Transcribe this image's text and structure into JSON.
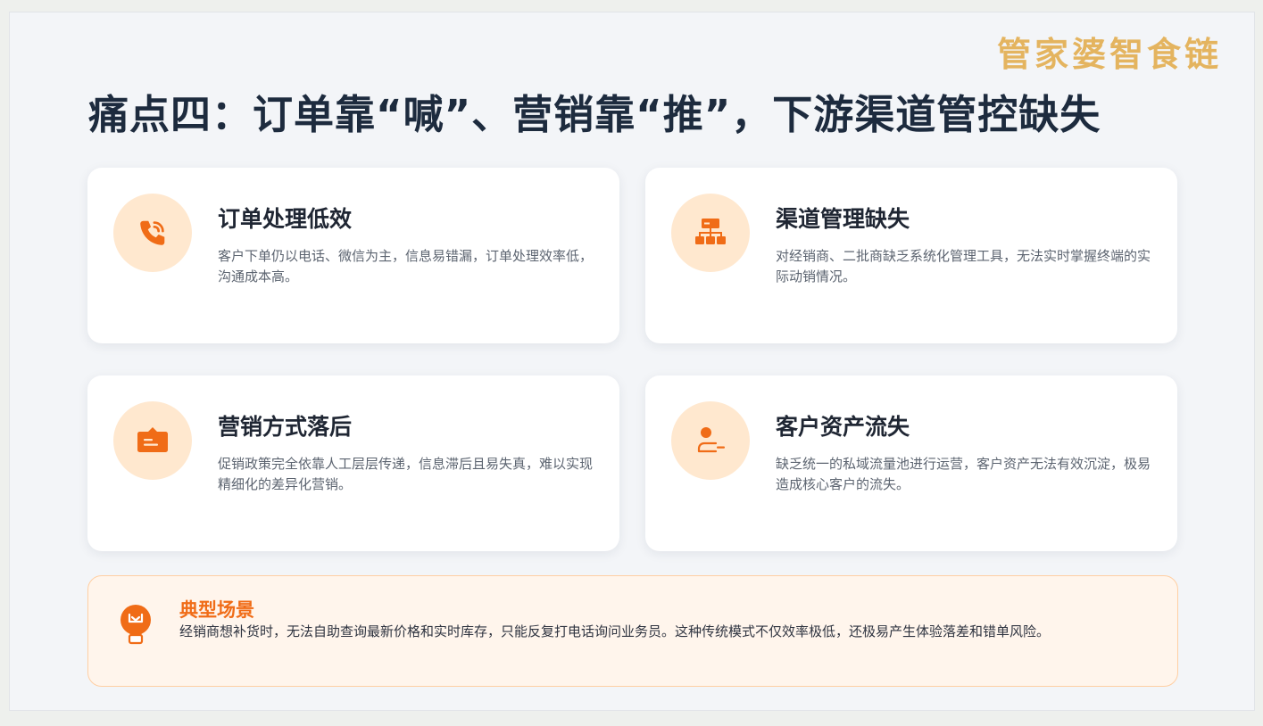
{
  "brand": {
    "name": "管家婆智食链",
    "accent": "#e4b45f"
  },
  "title": "痛点四：订单靠“喊”、营销靠“推”，下游渠道管控缺失",
  "cards": [
    {
      "icon": "phone-icon",
      "title": "订单处理低效",
      "desc": "客户下单仍以电话、微信为主，信息易错漏，订单处理效率低，沟通成本高。"
    },
    {
      "icon": "network-icon",
      "title": "渠道管理缺失",
      "desc": "对经销商、二批商缺乏系统化管理工具，无法实时掌握终端的实际动销情况。"
    },
    {
      "icon": "bullhorn-icon",
      "title": "营销方式落后",
      "desc": "促销政策完全依靠人工层层传递，信息滞后且易失真，难以实现精细化的差异化营销。"
    },
    {
      "icon": "user-minus-icon",
      "title": "客户资产流失",
      "desc": "缺乏统一的私域流量池进行运营，客户资产无法有效沉淀，极易造成核心客户的流失。"
    }
  ],
  "scenario": {
    "icon": "lightbulb-icon",
    "title": "典型场景",
    "desc": "经销商想补货时，无法自助查询最新价格和实时库存，只能反复打电话询问业务员。这种传统模式不仅效率极低，还极易产生体验落差和错单风险。"
  },
  "colors": {
    "primary": "#f06c17",
    "icon_bg": "#ffe8cf",
    "title": "#1d2b3e"
  }
}
